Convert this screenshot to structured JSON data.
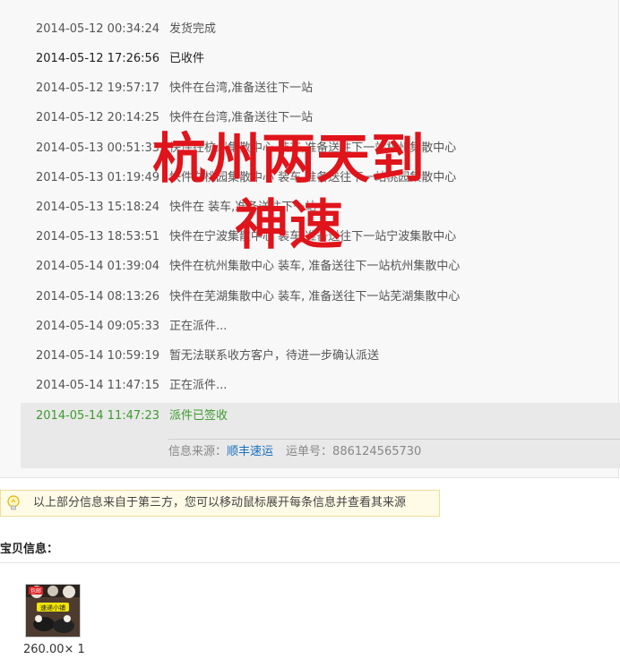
{
  "tracking": {
    "events": [
      {
        "time": "2014-05-12 00:34:24",
        "desc": "发货完成"
      },
      {
        "time": "2014-05-12 17:26:56",
        "desc": "已收件"
      },
      {
        "time": "2014-05-12 19:57:17",
        "desc": "快件在台湾,准备送往下一站"
      },
      {
        "time": "2014-05-12 20:14:25",
        "desc": "快件在台湾,准备送往下一站"
      },
      {
        "time": "2014-05-13 00:51:33",
        "desc": "快件在杭州集散中心 装车,准备送往下一站杭州集散中心"
      },
      {
        "time": "2014-05-13 01:19:49",
        "desc": "快件在桃园集散中心 装车,准备送往下一站桃园集散中心"
      },
      {
        "time": "2014-05-13 15:18:24",
        "desc": "快件在 装车,准备送往下一站"
      },
      {
        "time": "2014-05-13 18:53:51",
        "desc": "快件在宁波集散中心 装车,准备送往下一站宁波集散中心"
      },
      {
        "time": "2014-05-14 01:39:04",
        "desc": "快件在杭州集散中心 装车, 准备送往下一站杭州集散中心"
      },
      {
        "time": "2014-05-14 08:13:26",
        "desc": "快件在芜湖集散中心 装车, 准备送往下一站芜湖集散中心"
      },
      {
        "time": "2014-05-14 09:05:33",
        "desc": "正在派件..."
      },
      {
        "time": "2014-05-14 10:59:19",
        "desc": "暂无法联系收方客户，待进一步确认派送"
      },
      {
        "time": "2014-05-14 11:47:15",
        "desc": "正在派件..."
      },
      {
        "time": "2014-05-14 11:47:23",
        "desc": "派件已签收"
      }
    ],
    "source_label": "信息来源：",
    "carrier": "顺丰速运",
    "waybill_label": "运单号：",
    "waybill_no": "886124565730"
  },
  "overlay": {
    "line1": "杭州两天到",
    "line2": "神速",
    "color": "#e0141b"
  },
  "tip": {
    "icon": "lightbulb-icon",
    "text": "以上部分信息来自于第三方，您可以移动鼠标展开每条信息并查看其来源"
  },
  "item": {
    "section_title": "宝贝信息：",
    "thumb_label_top": "包邮",
    "thumb_label_mid": "速递小铺",
    "price_qty": "260.00× 1"
  }
}
